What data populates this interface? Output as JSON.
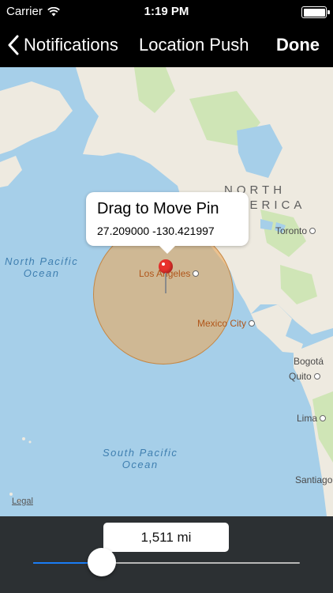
{
  "status_bar": {
    "carrier": "Carrier",
    "time": "1:19 PM"
  },
  "nav": {
    "back_label": "Notifications",
    "title": "Location Push",
    "done_label": "Done"
  },
  "map": {
    "callout": {
      "title": "Drag to Move Pin",
      "coords": "27.209000 -130.421997"
    },
    "labels": {
      "north_pacific": "North Pacific\nOcean",
      "south_pacific": "South Pacific\nOcean",
      "north_america": "NORTH\nAMERICA",
      "los_angeles": "Los Angeles",
      "toronto": "Toronto",
      "mexico_city": "Mexico City",
      "bogota": "Bogotá",
      "quito": "Quito",
      "lima": "Lima",
      "santiago": "Santiago"
    },
    "legal": "Legal"
  },
  "controls": {
    "distance": "1,511 mi",
    "slider_fraction": 0.18
  },
  "colors": {
    "ocean": "#a6cfe9",
    "land": "#eeeae0",
    "green": "#cfe5b6",
    "radius": "#e8aa60",
    "accent": "#1a7cf5"
  }
}
